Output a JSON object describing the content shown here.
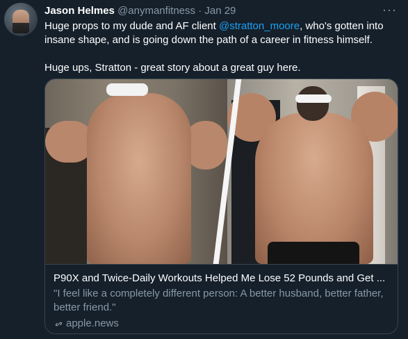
{
  "tweet": {
    "author_name": "Jason Helmes",
    "author_handle": "@anymanfitness",
    "separator": "·",
    "date": "Jan 29",
    "more_label": "···",
    "text_line1_before": "Huge props to my dude and AF client ",
    "mention": "@stratton_moore",
    "text_line1_after": ", who's gotten into insane shape, and is going down the path of a career in fitness himself.",
    "text_para2": "Huge ups, Stratton - great story about a great guy here."
  },
  "card": {
    "title": "P90X and Twice-Daily Workouts Helped Me Lose 52 Pounds and Get ...",
    "description": "\"I feel like a completely different person: A better husband, better father, better friend.\"",
    "domain": "apple.news",
    "link_icon": "link-icon"
  },
  "colors": {
    "background": "#15202b",
    "text_primary": "#ffffff",
    "text_secondary": "#8899a6",
    "accent": "#1da1f2",
    "border": "#38444d"
  }
}
